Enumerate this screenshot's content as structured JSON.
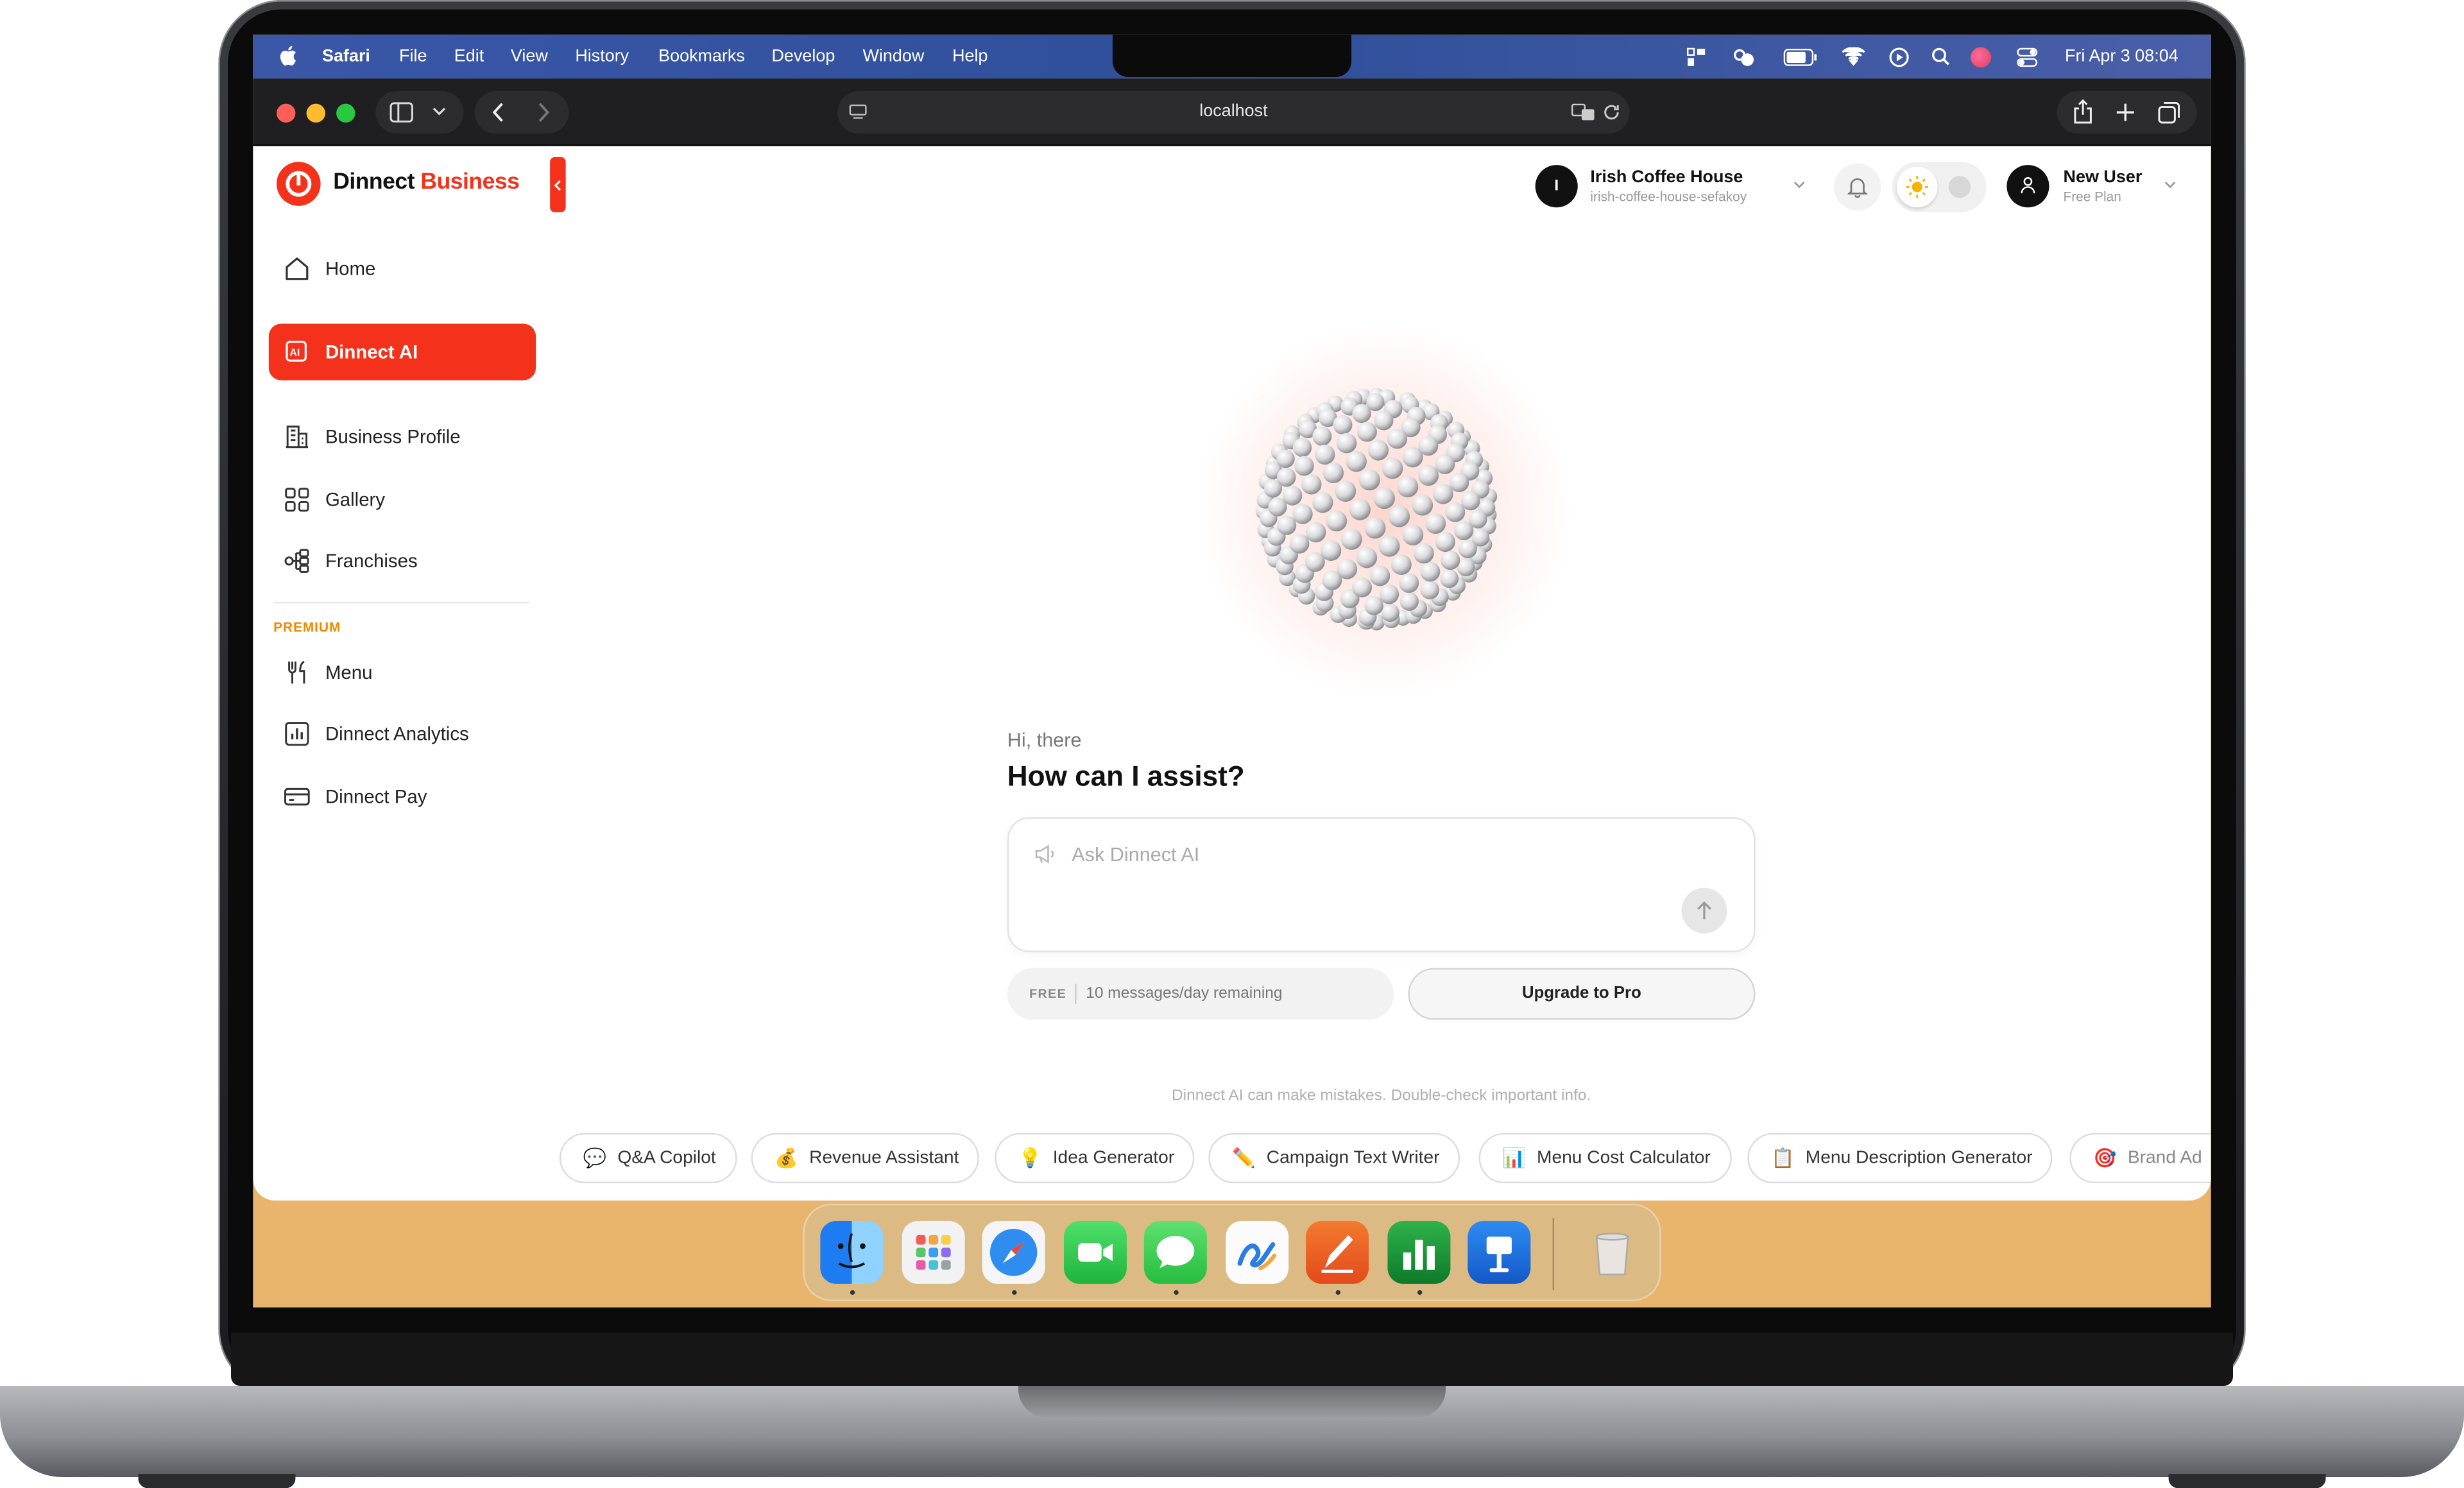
{
  "menubar": {
    "app_name": "Safari",
    "items": [
      "File",
      "Edit",
      "View",
      "History",
      "Bookmarks",
      "Develop",
      "Window",
      "Help"
    ],
    "datetime": "Fri Apr 3  08:04"
  },
  "browser": {
    "url": "localhost"
  },
  "brand": {
    "name_part1": "Dinnect",
    "name_part2": "Business",
    "accent": "#f4311b"
  },
  "sidebar": {
    "items": [
      {
        "label": "Home",
        "icon": "home-icon"
      },
      {
        "label": "Dinnect AI",
        "icon": "ai-icon",
        "active": true
      },
      {
        "label": "Business Profile",
        "icon": "building-icon"
      },
      {
        "label": "Gallery",
        "icon": "grid-icon"
      },
      {
        "label": "Franchises",
        "icon": "branches-icon"
      }
    ],
    "section_label": "PREMIUM",
    "section_color": "#f08a00",
    "premium_items": [
      {
        "label": "Menu",
        "icon": "utensils-icon"
      },
      {
        "label": "Dinnect Analytics",
        "icon": "chart-icon"
      },
      {
        "label": "Dinnect Pay",
        "icon": "card-icon"
      }
    ]
  },
  "header": {
    "business_initial": "I",
    "business_name": "Irish Coffee House",
    "business_slug": "irish-coffee-house-sefakoy",
    "user_name": "New User",
    "user_plan": "Free Plan"
  },
  "assistant": {
    "greeting": "Hi, there",
    "headline": "How can I assist?",
    "input_placeholder": "Ask Dinnect AI",
    "plan_badge": "FREE",
    "quota_text": "10 messages/day remaining",
    "upgrade_label": "Upgrade to Pro",
    "disclaimer": "Dinnect AI can make mistakes. Double-check important info."
  },
  "tools": [
    {
      "emoji": "💬",
      "label": "Q&A Copilot"
    },
    {
      "emoji": "💰",
      "label": "Revenue Assistant"
    },
    {
      "emoji": "💡",
      "label": "Idea Generator"
    },
    {
      "emoji": "✏️",
      "label": "Campaign Text Writer"
    },
    {
      "emoji": "📊",
      "label": "Menu Cost Calculator"
    },
    {
      "emoji": "📋",
      "label": "Menu Description Generator"
    },
    {
      "emoji": "🎯",
      "label": "Brand Ad"
    }
  ],
  "dock": {
    "apps": [
      "finder-icon",
      "launchpad-icon",
      "safari-icon",
      "facetime-icon",
      "messages-icon",
      "freeform-icon",
      "pages-icon",
      "numbers-icon",
      "keynote-icon",
      "trash-icon"
    ]
  }
}
